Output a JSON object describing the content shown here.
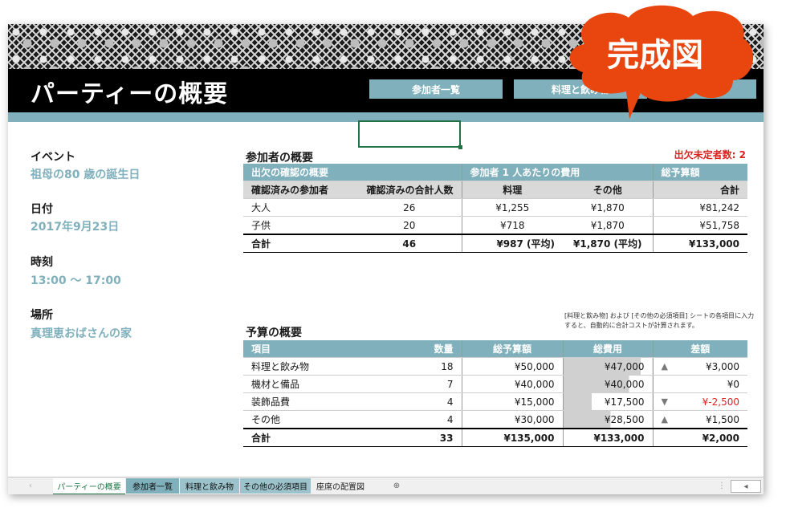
{
  "sheet": {
    "title": "パーティーの概要",
    "nav_buttons": [
      "参加者一覧",
      "料理と飲み物"
    ]
  },
  "badge": {
    "label": "完成図",
    "color": "#e8450f"
  },
  "info": {
    "event_label": "イベント",
    "event_value": "祖母の80 歳の誕生日",
    "date_label": "日付",
    "date_value": "2017年9月23日",
    "time_label": "時刻",
    "time_value": "13:00 ～ 17:00",
    "place_label": "場所",
    "place_value": "真理恵おばさんの家"
  },
  "attendees": {
    "title": "参加者の概要",
    "pending_label": "出欠未定者数:",
    "pending_value": "2",
    "group_headers": [
      "出欠の確認の概要",
      "参加者 1 人あたりの費用",
      "総予算額"
    ],
    "columns": [
      "確認済みの参加者",
      "確認済みの合計人数",
      "料理",
      "その他",
      "合計"
    ],
    "rows": [
      {
        "name": "大人",
        "count": "26",
        "food": "¥1,255",
        "other": "¥1,870",
        "total": "¥81,242"
      },
      {
        "name": "子供",
        "count": "20",
        "food": "¥718",
        "other": "¥1,870",
        "total": "¥51,758"
      }
    ],
    "total": {
      "name": "合計",
      "count": "46",
      "food": "¥987 (平均)",
      "other": "¥1,870 (平均)",
      "total": "¥133,000"
    }
  },
  "budget": {
    "title": "予算の概要",
    "note": "[料理と飲み物] および [その他の必須項目] シートの各項目に入力すると、自動的に合計コストが計算されます。",
    "columns": [
      "項目",
      "数量",
      "総予算額",
      "総費用",
      "差額"
    ],
    "rows": [
      {
        "item": "料理と飲み物",
        "qty": "18",
        "budget": "¥50,000",
        "cost": "¥47,000",
        "cost_fill": 0.87,
        "trend": "up",
        "diff": "¥3,000"
      },
      {
        "item": "機材と備品",
        "qty": "7",
        "budget": "¥40,000",
        "cost": "¥40,000",
        "cost_fill": 0.74,
        "trend": "",
        "diff": "¥0"
      },
      {
        "item": "装飾品費",
        "qty": "4",
        "budget": "¥15,000",
        "cost": "¥17,500",
        "cost_fill": 0.32,
        "trend": "down",
        "diff": "¥-2,500"
      },
      {
        "item": "その他",
        "qty": "4",
        "budget": "¥30,000",
        "cost": "¥28,500",
        "cost_fill": 0.53,
        "trend": "up",
        "diff": "¥1,500"
      }
    ],
    "total": {
      "item": "合計",
      "qty": "33",
      "budget": "¥135,000",
      "cost": "¥133,000",
      "diff": "¥2,000"
    }
  },
  "tabs": [
    "パーティーの概要",
    "参加者一覧",
    "料理と飲み物",
    "その他の必須項目",
    "座席の配置図"
  ],
  "colors": {
    "accent": "#7fb0bc",
    "header": "#000000",
    "negative": "#e02020",
    "excel_green": "#217346"
  }
}
